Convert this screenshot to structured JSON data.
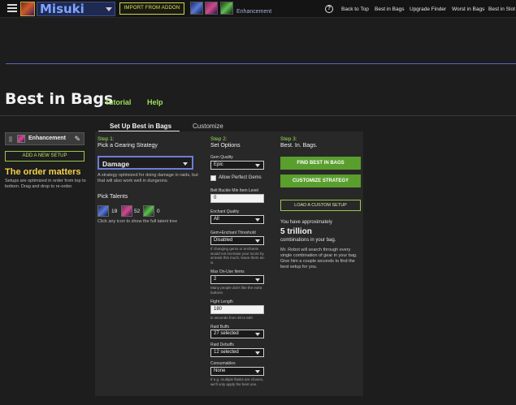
{
  "header": {
    "character_name": "Misuki",
    "import_label": "IMPORT FROM ADDON",
    "spec_label": "Enhancement",
    "help_symbol": "?",
    "nav": [
      "Back to Top",
      "Best in Bags",
      "Upgrade Finder",
      "Worst in Bags",
      "Best in Slot"
    ]
  },
  "page": {
    "title": "Best in Bags",
    "links": [
      "Tutorial",
      "Help"
    ]
  },
  "sidebar": {
    "setup_name": "Enhancement",
    "add_setup_label": "ADD A NEW SETUP",
    "order_title": "The order matters",
    "order_desc": "Setups are optimized in order from top to bottom. Drag and drop to re-order."
  },
  "tabs": {
    "active": "Set Up Best in Bags",
    "inactive": "Customize"
  },
  "step1": {
    "label": "Step 1:",
    "title": "Pick a Gearing Strategy",
    "strategy_value": "Damage",
    "strategy_desc": "A strategy optimized for doing damage in raids, but that will also work well in dungeons.",
    "talents_title": "Pick Talents",
    "talent_counts": [
      "19",
      "52",
      "0"
    ],
    "talents_hint": "Click any icon to show the full talent tree"
  },
  "step2": {
    "label": "Step 2:",
    "title": "Set Options",
    "gem_quality_label": "Gem Quality",
    "gem_quality_value": "Epic",
    "perfect_gems_label": "Allow Perfect Gems",
    "belt_buckle_label": "Belt Buckle Min Item Level",
    "belt_buckle_value": "0",
    "enchant_quality_label": "Enchant Quality",
    "enchant_quality_value": "All",
    "gem_enchant_threshold_label": "Gem+Enchant Threshold",
    "gem_enchant_threshold_value": "Disabled",
    "gem_enchant_threshold_note": "If changing gems or enchants would not increase your score by at least this much, leave them as-is.",
    "max_onuse_label": "Max On-Use Items",
    "max_onuse_value": "2",
    "max_onuse_note": "Many people don't like the extra buttons.",
    "fight_length_label": "Fight Length",
    "fight_length_value": "180",
    "fight_length_note": "in seconds from 30 to 600",
    "raid_buffs_label": "Raid Buffs",
    "raid_buffs_value": "27 selected",
    "raid_debuffs_label": "Raid Debuffs",
    "raid_debuffs_value": "12 selected",
    "consumables_label": "Consumables",
    "consumables_value": "None",
    "consumables_note": "If e.g. multiple flasks are chosen, we'll only apply the best one."
  },
  "step3": {
    "label": "Step 3:",
    "title": "Best. In. Bags.",
    "find_label": "FIND BEST IN BAGS",
    "customize_label": "CUSTOMIZE STRATEGY",
    "load_label": "LOAD A CUSTOM SETUP",
    "approx_text": "You have approximately",
    "combos_value": "5 trillion",
    "combos_sub": "combinations in your bag.",
    "robot_desc": "Mr. Robot will search through every single combination of gear in your bag. Give him a couple seconds to find the best setup for you."
  }
}
